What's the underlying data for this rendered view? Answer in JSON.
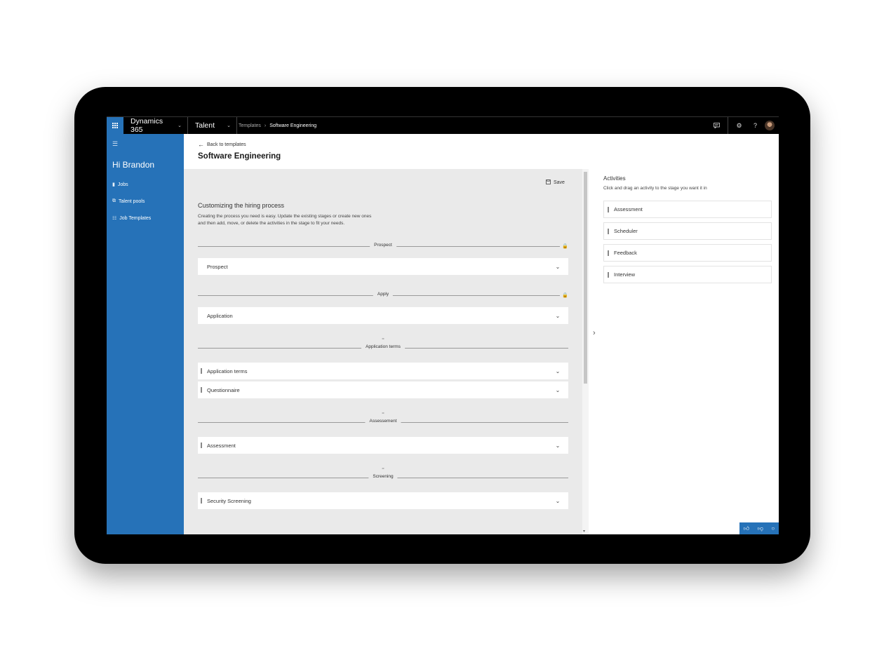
{
  "topbar": {
    "brand": "Dynamics 365",
    "app": "Talent",
    "breadcrumb": [
      "Templates",
      "Software Engineering"
    ],
    "icons": [
      "chat-icon",
      "gear-icon",
      "help-icon",
      "avatar"
    ]
  },
  "sidebar": {
    "greeting": "Hi Brandon",
    "items": [
      {
        "label": "Jobs",
        "icon": "jobs-icon"
      },
      {
        "label": "Talent pools",
        "icon": "talent-pools-icon"
      },
      {
        "label": "Job Templates",
        "icon": "job-templates-icon"
      }
    ]
  },
  "header": {
    "back_label": "Back to templates",
    "title": "Software Engineering"
  },
  "main": {
    "save_label": "Save",
    "intro_title": "Customizing the hiring process",
    "intro_text": "Creating the process you need is easy. Update the existing stages or create new ones and then add, move, or delete the activities in the stage to fit your needs.",
    "stages": [
      {
        "name": "Prospect",
        "locked": true,
        "activities": [
          "Prospect"
        ]
      },
      {
        "name": "Apply",
        "locked": true,
        "activities": [
          "Application"
        ]
      },
      {
        "name": "Application terms",
        "locked": false,
        "activities": [
          "Application terms",
          "Questionnaire"
        ]
      },
      {
        "name": "Assessement",
        "locked": false,
        "activities": [
          "Assessment"
        ]
      },
      {
        "name": "Screening",
        "locked": false,
        "activities": [
          "Security Screening"
        ]
      }
    ]
  },
  "activities_panel": {
    "title": "Activities",
    "subtitle": "Click and drag an activity to the stage you want it in",
    "items": [
      "Assessment",
      "Scheduler",
      "Feedback",
      "Interview"
    ]
  },
  "colors": {
    "brand_blue": "#2672b8",
    "topbar": "#000000",
    "canvas": "#eaeaea"
  }
}
